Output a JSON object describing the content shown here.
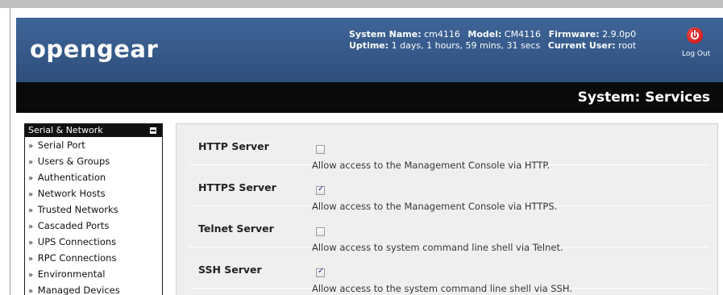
{
  "header": {
    "logo": "opengear",
    "system_name_label": "System Name:",
    "system_name": "cm4116",
    "model_label": "Model:",
    "model": "CM4116",
    "firmware_label": "Firmware:",
    "firmware": "2.9.0p0",
    "uptime_label": "Uptime:",
    "uptime": "1 days, 1 hours, 59 mins, 31 secs",
    "user_label": "Current User:",
    "user": "root",
    "logout_label": "Log Out",
    "logout_icon": "power-icon"
  },
  "page_title": "System: Services",
  "sidebar": {
    "section_title": "Serial & Network",
    "items": [
      {
        "label": "Serial Port"
      },
      {
        "label": "Users & Groups"
      },
      {
        "label": "Authentication"
      },
      {
        "label": "Network Hosts"
      },
      {
        "label": "Trusted Networks"
      },
      {
        "label": "Cascaded Ports"
      },
      {
        "label": "UPS Connections"
      },
      {
        "label": "RPC Connections"
      },
      {
        "label": "Environmental"
      },
      {
        "label": "Managed Devices"
      }
    ]
  },
  "services": [
    {
      "label": "HTTP Server",
      "checked": false,
      "description": "Allow access to the Management Console via HTTP."
    },
    {
      "label": "HTTPS Server",
      "checked": true,
      "description": "Allow access to the Management Console via HTTPS."
    },
    {
      "label": "Telnet Server",
      "checked": false,
      "description": "Allow access to system command line shell via Telnet."
    },
    {
      "label": "SSH Server",
      "checked": true,
      "description": "Allow access to the system command line shell via SSH."
    }
  ],
  "colors": {
    "header_blue": "#3e6598",
    "titlebar": "#0a0a0a",
    "logout_red": "#d40000"
  }
}
